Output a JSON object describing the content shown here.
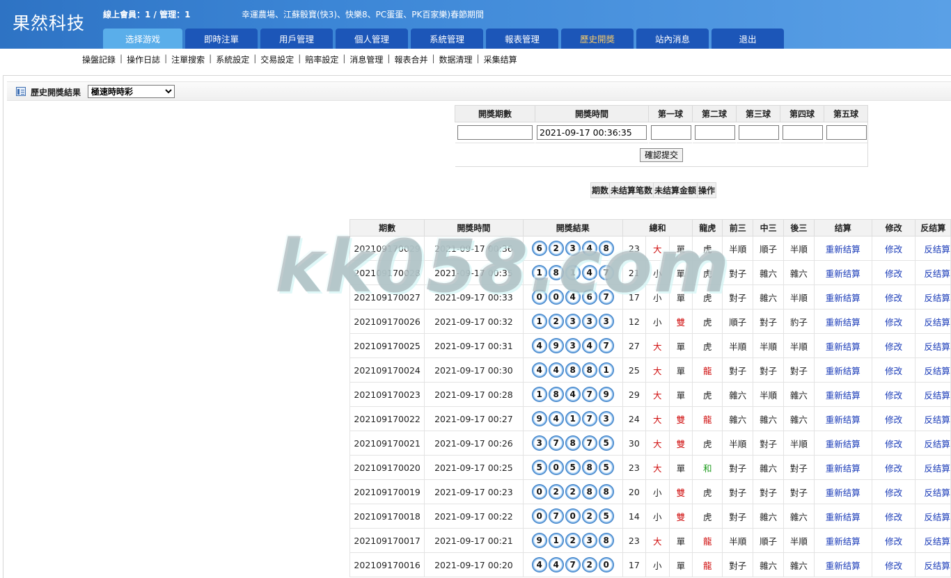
{
  "header": {
    "logo": "果然科技",
    "online": "線上會員：1 / 管理：1",
    "marquee": "幸運農場、江蘇骰寶(快3)、快樂8、PC蛋蛋、PK百家樂)春節期間",
    "tabs": [
      "选择游戏",
      "即時注單",
      "用戶管理",
      "個人管理",
      "系統管理",
      "報表管理",
      "歷史開獎",
      "站內消息",
      "退出"
    ]
  },
  "subnav": [
    "操盤記錄",
    "操作日誌",
    "注單搜索",
    "系統設定",
    "交易設定",
    "賠率設定",
    "消息管理",
    "報表合并",
    "数据清理",
    "采集结算"
  ],
  "panel": {
    "title": "歷史開獎結果",
    "game_select": "極速時時彩"
  },
  "form": {
    "headers": [
      "開獎期數",
      "開獎時間",
      "第一球",
      "第二球",
      "第三球",
      "第四球",
      "第五球"
    ],
    "time_value": "2021-09-17 00:36:35",
    "submit": "確認提交"
  },
  "unsettled_headers": [
    "期数",
    "未结算笔数",
    "未结算金额",
    "操作"
  ],
  "results": {
    "headers": [
      "期數",
      "開獎時間",
      "開獎結果",
      "總和",
      "龍虎",
      "前三",
      "中三",
      "後三",
      "结算",
      "修改",
      "反结算"
    ],
    "action_settle": "重新结算",
    "action_edit": "修改",
    "action_reverse": "反结算",
    "rows": [
      {
        "period": "202109170029",
        "time": "2021-09-17 00:36",
        "balls": [
          "6",
          "2",
          "3",
          "4",
          "8"
        ],
        "sum": "23",
        "size": "大",
        "parity": "單",
        "dragon": "虎",
        "front": "半順",
        "mid": "順子",
        "back": "半順"
      },
      {
        "period": "202109170028",
        "time": "2021-09-17 00:35",
        "balls": [
          "1",
          "8",
          "1",
          "4",
          "7"
        ],
        "sum": "21",
        "size": "小",
        "parity": "單",
        "dragon": "虎",
        "front": "對子",
        "mid": "雜六",
        "back": "雜六"
      },
      {
        "period": "202109170027",
        "time": "2021-09-17 00:33",
        "balls": [
          "0",
          "0",
          "4",
          "6",
          "7"
        ],
        "sum": "17",
        "size": "小",
        "parity": "單",
        "dragon": "虎",
        "front": "對子",
        "mid": "雜六",
        "back": "半順"
      },
      {
        "period": "202109170026",
        "time": "2021-09-17 00:32",
        "balls": [
          "1",
          "2",
          "3",
          "3",
          "3"
        ],
        "sum": "12",
        "size": "小",
        "parity": "雙",
        "dragon": "虎",
        "front": "順子",
        "mid": "對子",
        "back": "豹子"
      },
      {
        "period": "202109170025",
        "time": "2021-09-17 00:31",
        "balls": [
          "4",
          "9",
          "3",
          "4",
          "7"
        ],
        "sum": "27",
        "size": "大",
        "parity": "單",
        "dragon": "虎",
        "front": "半順",
        "mid": "半順",
        "back": "半順"
      },
      {
        "period": "202109170024",
        "time": "2021-09-17 00:30",
        "balls": [
          "4",
          "4",
          "8",
          "8",
          "1"
        ],
        "sum": "25",
        "size": "大",
        "parity": "單",
        "dragon": "龍",
        "front": "對子",
        "mid": "對子",
        "back": "對子"
      },
      {
        "period": "202109170023",
        "time": "2021-09-17 00:28",
        "balls": [
          "1",
          "8",
          "4",
          "7",
          "9"
        ],
        "sum": "29",
        "size": "大",
        "parity": "單",
        "dragon": "虎",
        "front": "雜六",
        "mid": "半順",
        "back": "雜六"
      },
      {
        "period": "202109170022",
        "time": "2021-09-17 00:27",
        "balls": [
          "9",
          "4",
          "1",
          "7",
          "3"
        ],
        "sum": "24",
        "size": "大",
        "parity": "雙",
        "dragon": "龍",
        "front": "雜六",
        "mid": "雜六",
        "back": "雜六"
      },
      {
        "period": "202109170021",
        "time": "2021-09-17 00:26",
        "balls": [
          "3",
          "7",
          "8",
          "7",
          "5"
        ],
        "sum": "30",
        "size": "大",
        "parity": "雙",
        "dragon": "虎",
        "front": "半順",
        "mid": "對子",
        "back": "半順"
      },
      {
        "period": "202109170020",
        "time": "2021-09-17 00:25",
        "balls": [
          "5",
          "0",
          "5",
          "8",
          "5"
        ],
        "sum": "23",
        "size": "大",
        "parity": "單",
        "dragon": "和",
        "front": "對子",
        "mid": "雜六",
        "back": "對子"
      },
      {
        "period": "202109170019",
        "time": "2021-09-17 00:23",
        "balls": [
          "0",
          "2",
          "2",
          "8",
          "8"
        ],
        "sum": "20",
        "size": "小",
        "parity": "雙",
        "dragon": "虎",
        "front": "對子",
        "mid": "對子",
        "back": "對子"
      },
      {
        "period": "202109170018",
        "time": "2021-09-17 00:22",
        "balls": [
          "0",
          "7",
          "0",
          "2",
          "5"
        ],
        "sum": "14",
        "size": "小",
        "parity": "雙",
        "dragon": "虎",
        "front": "對子",
        "mid": "雜六",
        "back": "雜六"
      },
      {
        "period": "202109170017",
        "time": "2021-09-17 00:21",
        "balls": [
          "9",
          "1",
          "2",
          "3",
          "8"
        ],
        "sum": "23",
        "size": "大",
        "parity": "單",
        "dragon": "龍",
        "front": "半順",
        "mid": "順子",
        "back": "半順"
      },
      {
        "period": "202109170016",
        "time": "2021-09-17 00:20",
        "balls": [
          "4",
          "4",
          "7",
          "2",
          "0"
        ],
        "sum": "17",
        "size": "小",
        "parity": "單",
        "dragon": "龍",
        "front": "對子",
        "mid": "雜六",
        "back": "雜六"
      }
    ]
  },
  "watermark": "kk058.com",
  "colors": {
    "header_blue": "#2e73c4",
    "tab_blue": "#1c56b8",
    "tab_active": "#5aaeea",
    "red": "#d01010",
    "green": "#1b9a1b",
    "link": "#1a3bb8"
  }
}
